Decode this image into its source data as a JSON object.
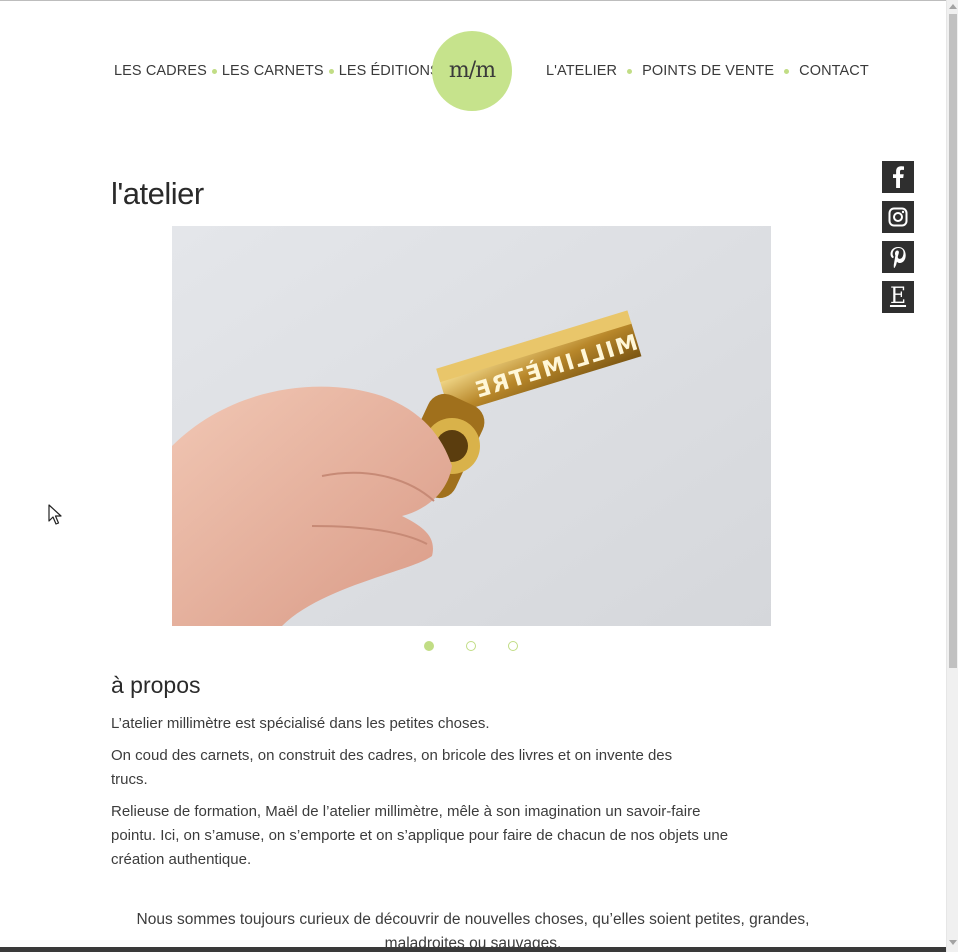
{
  "nav": {
    "left_items": [
      "LES CADRES",
      "LES CARNETS",
      "LES ÉDITIONS"
    ],
    "right_items": [
      "L'ATELIER",
      "POINTS DE VENTE",
      "CONTACT"
    ],
    "logo_text": "m/m"
  },
  "social": [
    "facebook-icon",
    "instagram-icon",
    "pinterest-icon",
    "etsy-icon"
  ],
  "etsy_letter": "E",
  "page_title": "l'atelier",
  "slider": {
    "stamp_text": "MILLIMÈTRE",
    "dots": 3,
    "active": 0
  },
  "about": {
    "title": "à propos",
    "p1": "L’atelier millimètre est spécialisé dans les petites choses.",
    "p2": "On coud des carnets, on construit des cadres, on bricole des livres et on invente des trucs.",
    "p3": "Relieuse de formation, Maël de l’atelier millimètre, mêle à son imagination un savoir-faire pointu. Ici, on s’amuse, on s’emporte et on s’applique pour faire de chacun de nos objets une création authentique.",
    "closing": "Nous sommes toujours curieux de découvrir de nouvelles choses, qu’elles soient petites, grandes, maladroites ou sauvages."
  },
  "colors": {
    "accent": "#c1dd85",
    "logo_bg": "#c6e38c",
    "social_bg": "#2f2f2f"
  }
}
